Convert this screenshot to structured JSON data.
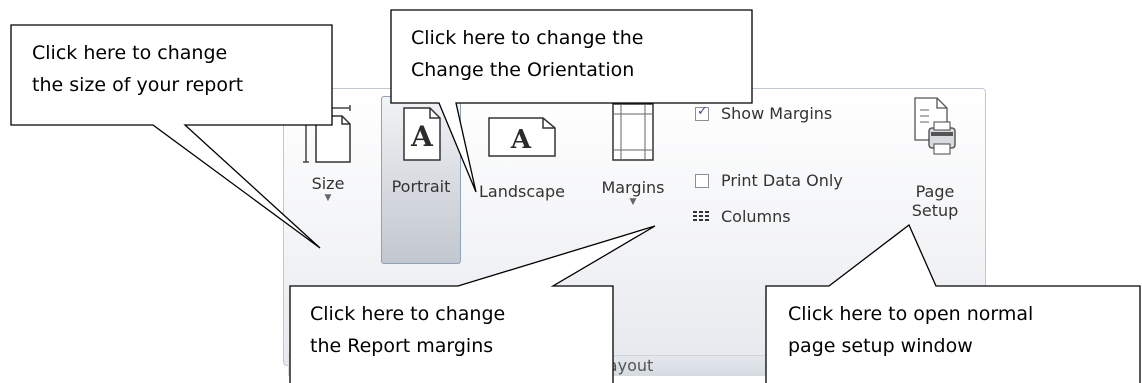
{
  "ribbon": {
    "group_label": "Page Layout",
    "group_label_visible": "age Layout",
    "size_label": "Size",
    "portrait_label": "Portrait",
    "landscape_label": "Landscape",
    "margins_label": "Margins",
    "show_margins_label": "Show Margins",
    "show_margins_checked": true,
    "print_data_only_label": "Print Data Only",
    "print_data_only_checked": false,
    "columns_label": "Columns",
    "page_setup_label_1": "Page",
    "page_setup_label_2": "Setup"
  },
  "callouts": {
    "size_line1": "Click here to change",
    "size_line2": "the size of your report",
    "orientation_line1": "Click here to change the",
    "orientation_line2": "Change the Orientation",
    "margins_line1": "Click here to change",
    "margins_line2": "the Report margins",
    "setup_line1": "Click here to open normal",
    "setup_line2": "page setup window"
  },
  "colors": {
    "ribbon_border": "#bfc8d4",
    "portrait_selected": "#c2c7cf"
  },
  "icons": [
    "size-icon",
    "portrait-icon",
    "landscape-icon",
    "margins-icon",
    "checkbox-icon",
    "columns-icon",
    "page-setup-icon",
    "dialog-launcher-icon"
  ]
}
